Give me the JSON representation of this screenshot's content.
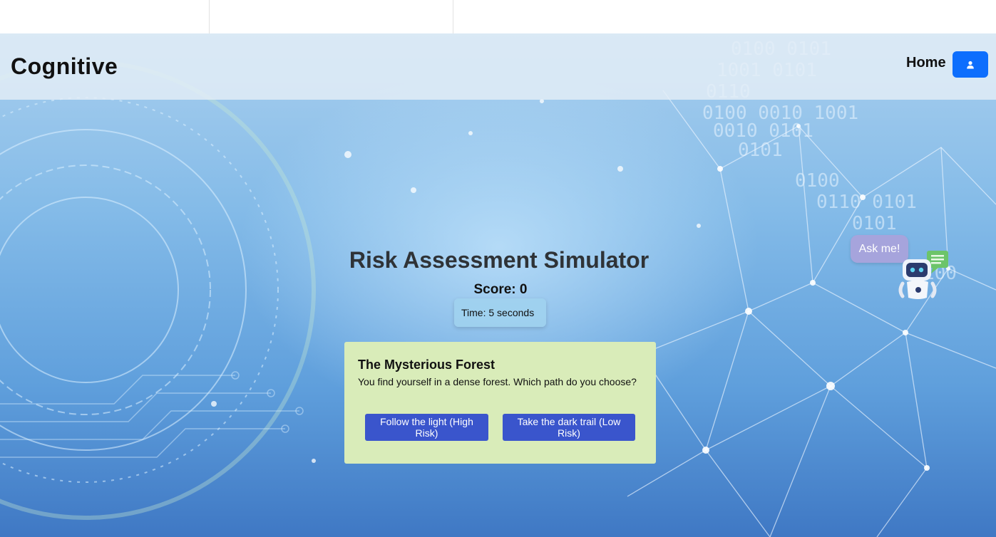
{
  "navbar": {
    "brand": "Cognitive",
    "home_label": "Home",
    "user_icon": "user-icon"
  },
  "game": {
    "title": "Risk Assessment Simulator",
    "score_text": "Score: 0",
    "time_text": "Time: 5 seconds"
  },
  "scenario": {
    "title": "The Mysterious Forest",
    "description": "You find yourself in a dense forest. Which path do you choose?",
    "choices": [
      {
        "label": "Follow the light (High Risk)"
      },
      {
        "label": "Take the dark trail (Low Risk)"
      }
    ]
  },
  "chatbot": {
    "bubble_label": "Ask me!",
    "icon": "robot-icon"
  },
  "colors": {
    "primary_button": "#0d6efd",
    "choice_button": "#3a55cc",
    "card_background": "#d9ecb9",
    "chat_bubble": "#a6a4dc"
  }
}
